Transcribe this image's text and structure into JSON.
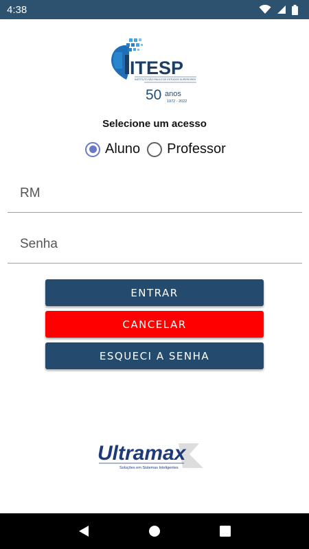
{
  "status_bar": {
    "time": "4:38",
    "icons": [
      "wifi-icon",
      "signal-icon",
      "battery-icon"
    ]
  },
  "logo": {
    "name": "ITESP",
    "tagline": "INSTITUTO SÃO PAULO DE ESTUDOS SUPERIORES",
    "anniversary_number": "50",
    "anniversary_word": "anos",
    "anniversary_years": "1972 - 2022"
  },
  "access": {
    "title": "Selecione um acesso",
    "options": [
      {
        "label": "Aluno",
        "selected": true
      },
      {
        "label": "Professor",
        "selected": false
      }
    ]
  },
  "form": {
    "rm_placeholder": "RM",
    "rm_value": "",
    "senha_placeholder": "Senha",
    "senha_value": ""
  },
  "buttons": {
    "entrar": "ENTRAR",
    "cancelar": "CANCELAR",
    "esqueci": "ESQUECI A SENHA"
  },
  "footer_logo": {
    "name": "Ultramax",
    "tagline": "Soluções em Sistemas Inteligentes"
  },
  "nav_bar": {
    "icons": [
      "back-icon",
      "home-icon",
      "recents-icon"
    ]
  },
  "colors": {
    "primary": "#244b6d",
    "danger": "#ff0000",
    "radio_accent": "#6b79c5",
    "status_bar": "#2c5270",
    "logo_blue": "#1f4e79"
  }
}
